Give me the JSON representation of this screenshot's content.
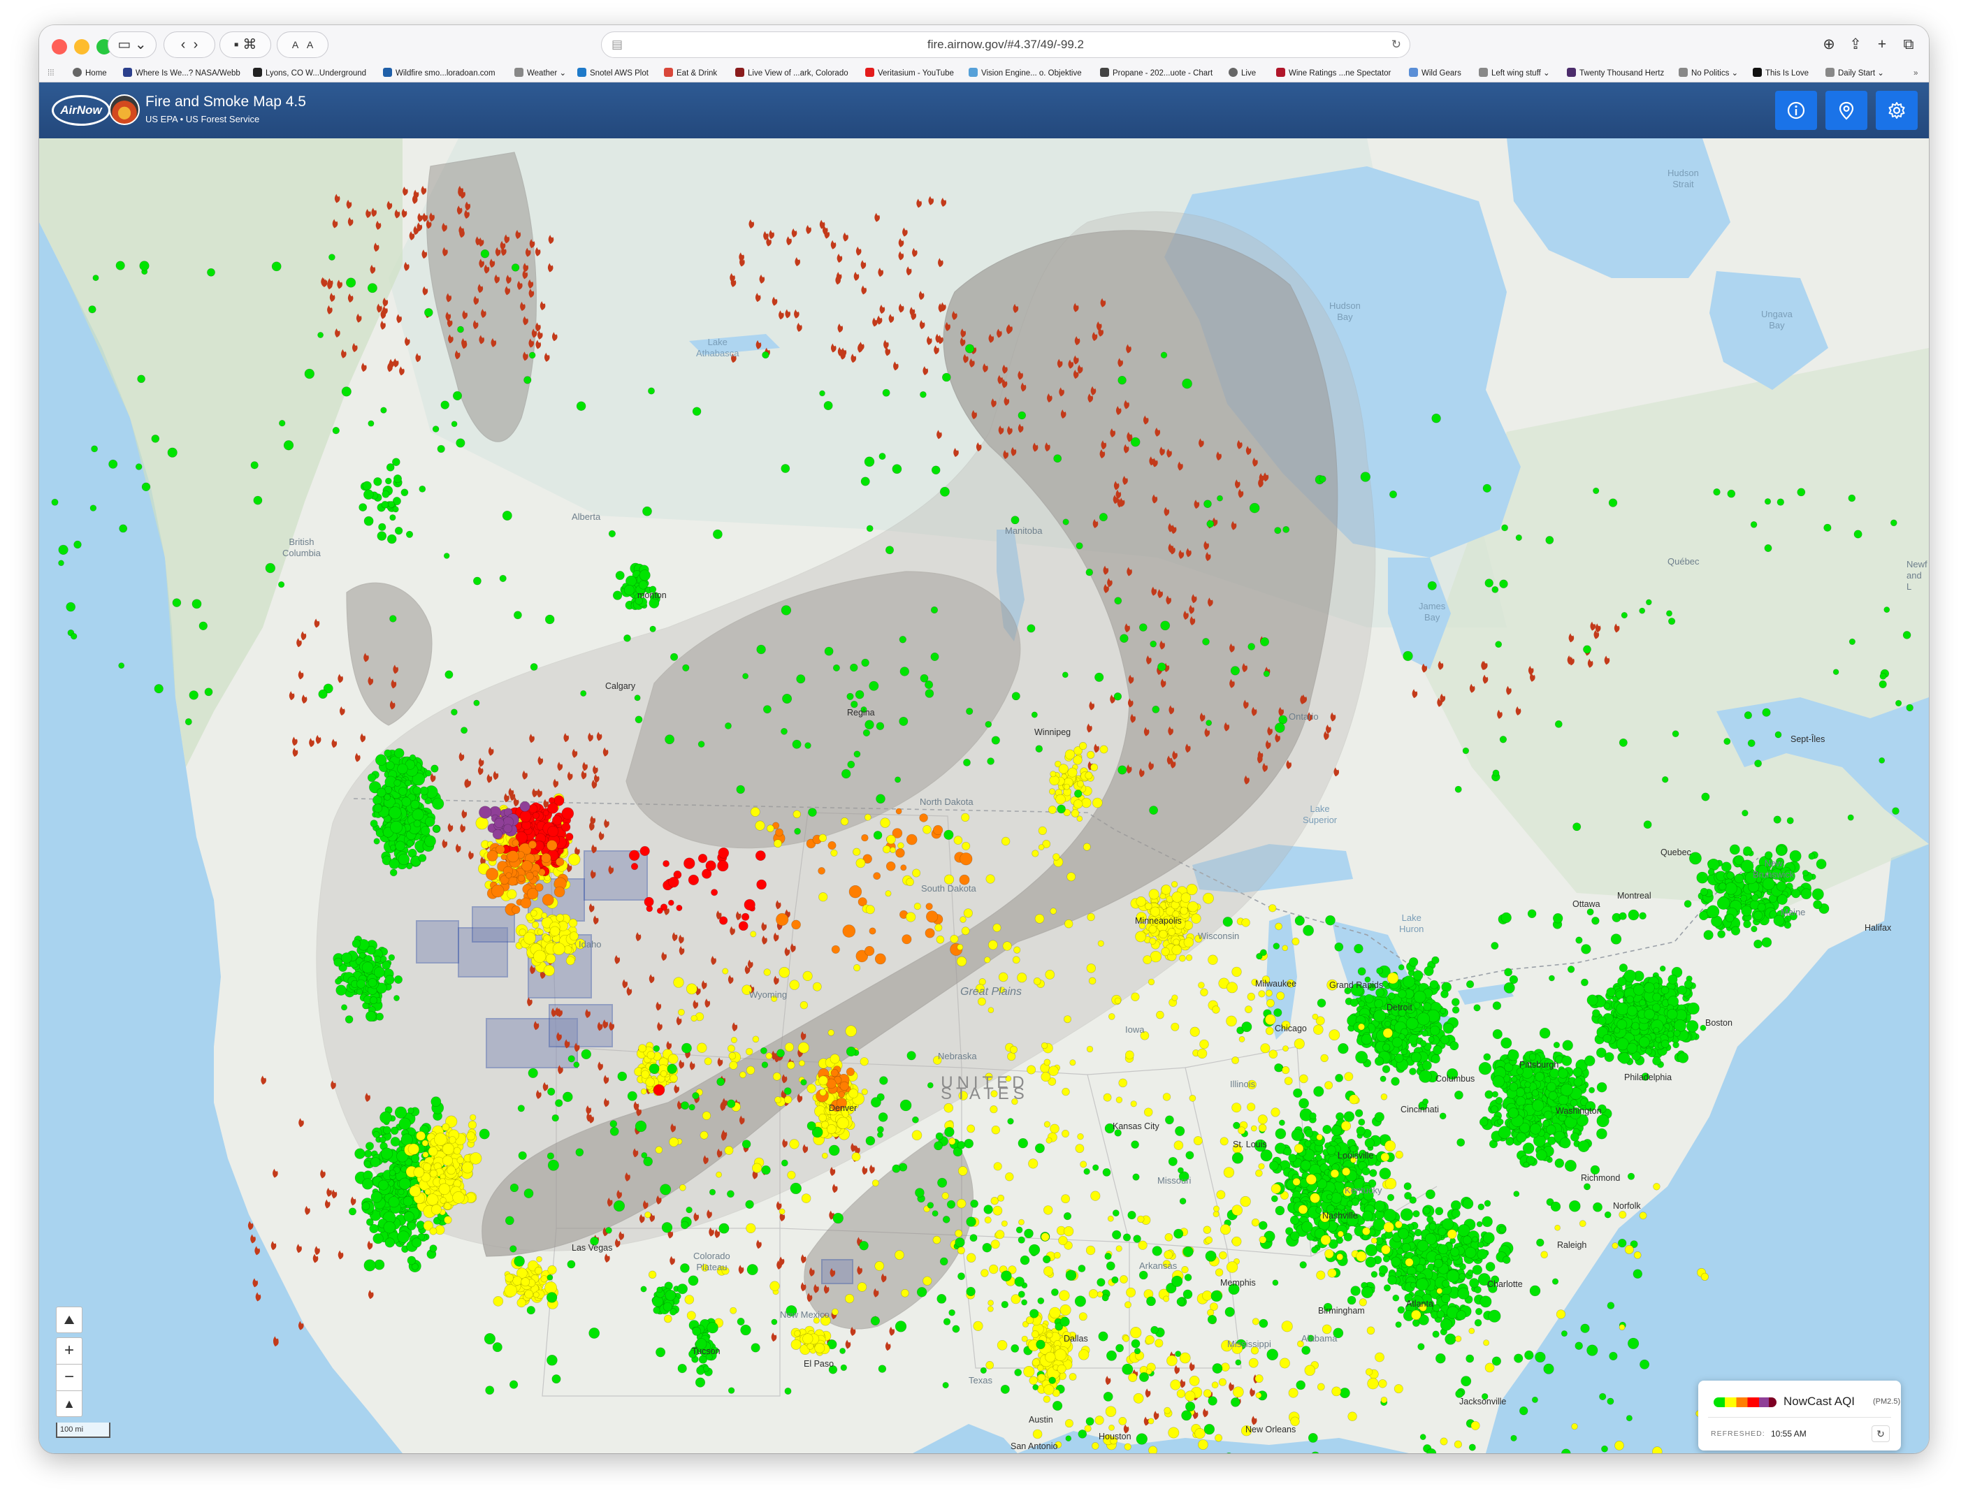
{
  "browser": {
    "url": "fire.airnow.gov/#4.37/49/-99.2",
    "favorites": [
      {
        "label": "Home",
        "color": "#666666"
      },
      {
        "label": "Where Is We...? NASA/Webb",
        "color": "#2b3f8c"
      },
      {
        "label": "Lyons, CO W...Underground",
        "color": "#222222"
      },
      {
        "label": "Wildfire smo...loradoan.com",
        "color": "#1f5fa8"
      },
      {
        "label": "Weather",
        "color": "#888888"
      },
      {
        "label": "Snotel AWS Plot",
        "color": "#1f7ac9"
      },
      {
        "label": "Eat & Drink",
        "color": "#d9473a"
      },
      {
        "label": "Live View of ...ark, Colorado",
        "color": "#8a1c1c"
      },
      {
        "label": "Veritasium - YouTube",
        "color": "#e31b1b"
      },
      {
        "label": "Vision Engine... o. Objektive",
        "color": "#56a0d8"
      },
      {
        "label": "Propane - 202...uote - Chart",
        "color": "#444444"
      },
      {
        "label": "Live",
        "color": "#666666"
      },
      {
        "label": "Wine Ratings ...ne Spectator",
        "color": "#b0162a"
      },
      {
        "label": "Wild Gears",
        "color": "#5a8ed6"
      },
      {
        "label": "Left wing stuff",
        "color": "#888888"
      },
      {
        "label": "Twenty Thousand Hertz",
        "color": "#4b2c6b"
      },
      {
        "label": "No Politics",
        "color": "#888888"
      },
      {
        "label": "This Is Love",
        "color": "#111111"
      },
      {
        "label": "Daily Start",
        "color": "#888888"
      }
    ]
  },
  "app": {
    "logo_text": "AirNow",
    "title": "Fire and Smoke Map 4.5",
    "subtitle": "US EPA • US Forest Service"
  },
  "map": {
    "labels": {
      "hudson_strait": "Hudson\nStrait",
      "hudson_bay": "Hudson\nBay",
      "ungava_bay": "Ungava\nBay",
      "lake_athabasca": "Lake\nAthabasca",
      "alberta": "Alberta",
      "british_columbia": "British\nColumbia",
      "manitoba": "Manitoba",
      "quebec_prov": "Québec",
      "newfoundland": "Newf\nand L",
      "james_bay": "James\nBay",
      "ontario": "Ontario",
      "edmonton": "monton",
      "calgary": "Calgary",
      "regina": "Regina",
      "winnipeg": "Winnipeg",
      "sept_iles": "Sept-Îles",
      "lake_superior": "Lake\nSuperior",
      "north_dakota": "North Dakota",
      "south_dakota": "South Dakota",
      "idaho": "Idaho",
      "wyoming": "Wyoming",
      "great_plains": "Great Plains",
      "nebraska": "Nebraska",
      "united_states": "UNITED\nSTATES",
      "quebec_city": "Quebec",
      "new_brunswick": "New\nBrunswick",
      "maine": "Maine",
      "halifax": "Halifax",
      "ottawa": "Ottawa",
      "montreal": "Montreal",
      "lake_huron": "Lake\nHuron",
      "minneapolis": "Minneapolis",
      "wisconsin": "Wisconsin",
      "milwaukee": "Milwaukee",
      "grand_rapids": "Grand Rapids",
      "chicago": "Chicago",
      "detroit": "Detroit",
      "boston": "Boston",
      "iowa": "Iowa",
      "illinois": "Illinois",
      "pittsburgh": "Pittsburgh",
      "columbus": "Columbus",
      "cincinnati": "Cincinnati",
      "philadelphia": "Philadelphia",
      "washington": "Washington",
      "kansas_city": "Kansas City",
      "st_louis": "St. Louis",
      "louisville": "Louisville",
      "missouri": "Missouri",
      "kentucky": "Kentucky",
      "richmond": "Richmond",
      "norfolk": "Norfolk",
      "denver": "Denver",
      "colorado_plateau": "Colorado\nPlateau",
      "las_vegas": "Las Vegas",
      "arkansas": "Arkansas",
      "memphis": "Memphis",
      "nashville": "Nashville",
      "raleigh": "Raleigh",
      "charlotte": "Charlotte",
      "new_mexico": "New Mexico",
      "dallas": "Dallas",
      "tucson": "Tucson",
      "el_paso": "El Paso",
      "mississippi": "Mississippi",
      "alabama": "Alabama",
      "birmingham": "Birmingham",
      "atlanta": "Atlanta",
      "texas": "Texas",
      "austin": "Austin",
      "san_antonio": "San Antonio",
      "houston": "Houston",
      "new_orleans": "New Orleans",
      "jacksonville": "Jacksonville"
    },
    "scale_label": "100 mi",
    "marker_colors": {
      "good": "#00e400",
      "moderate": "#ffff00",
      "usg": "#ff7e00",
      "unhealthy": "#ff0000",
      "very_unhealthy": "#8f3f97",
      "fire": "#c33a1a",
      "smoke": "#9a9590"
    }
  },
  "legend": {
    "title": "NowCast AQI",
    "subtitle": "(PM2.5)",
    "refreshed_label": "REFRESHED:",
    "refreshed_time": "10:55 AM"
  }
}
